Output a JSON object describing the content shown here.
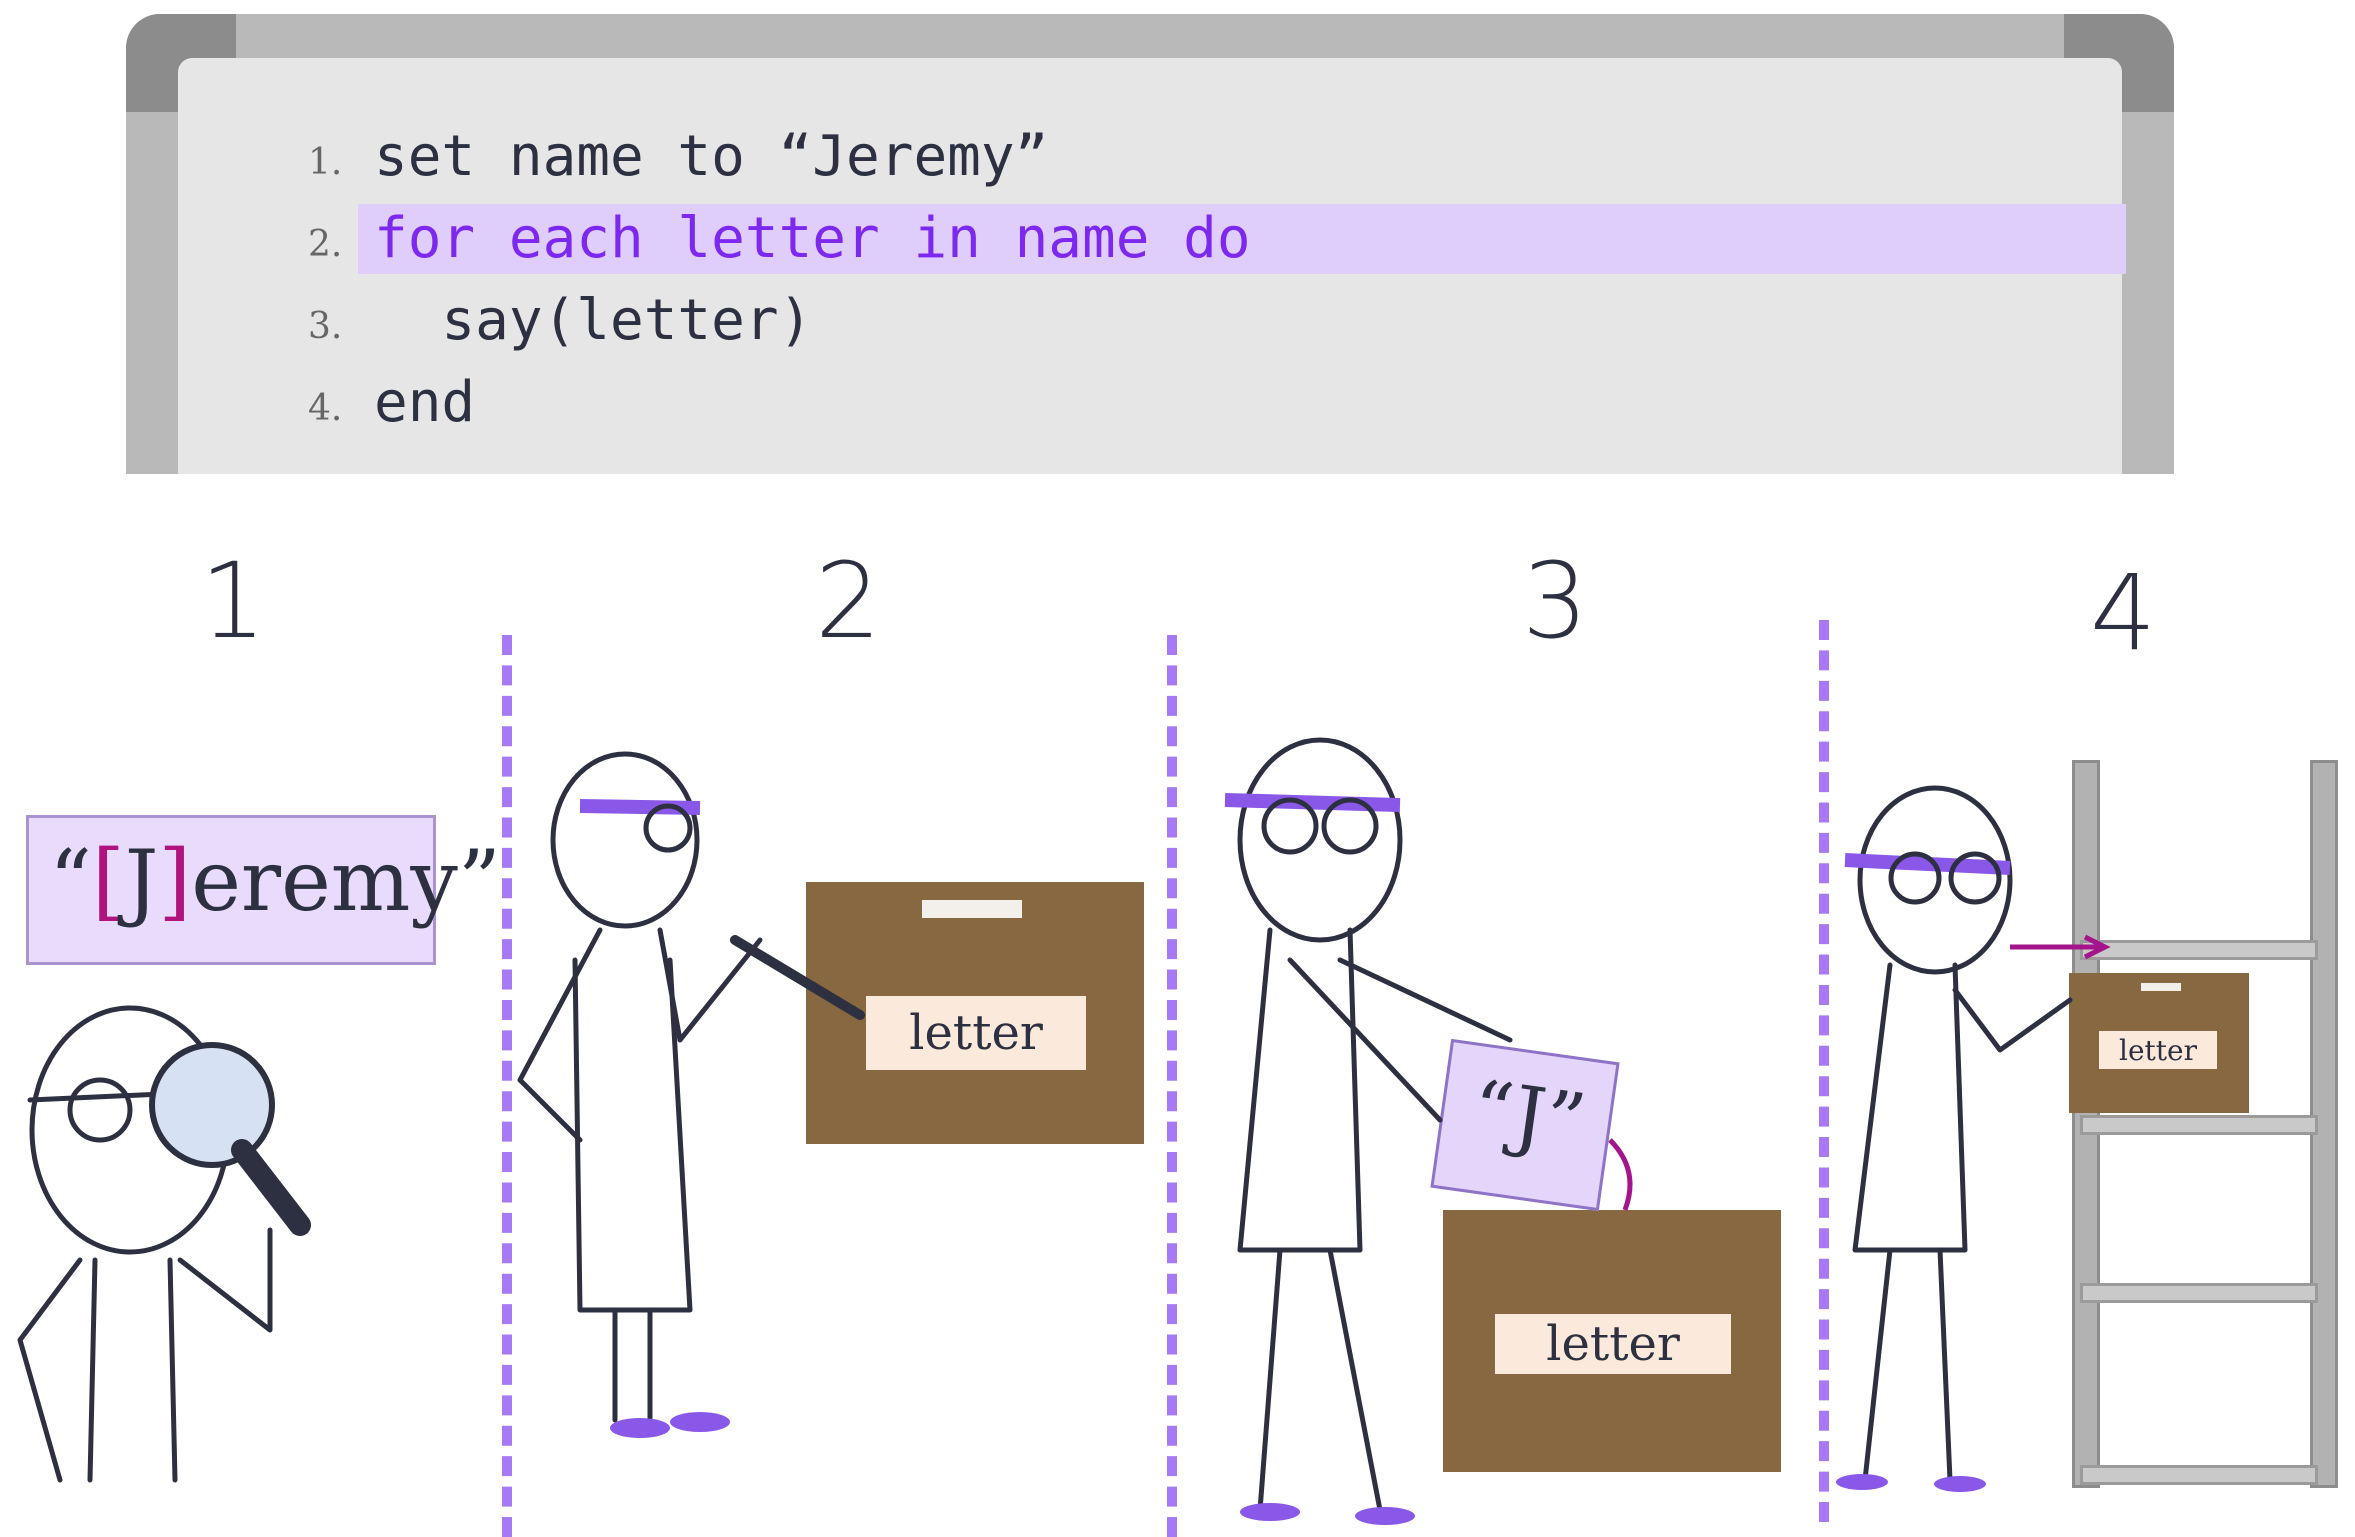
{
  "code": {
    "lines": [
      {
        "num": "1.",
        "text": "set name to “Jeremy”"
      },
      {
        "num": "2.",
        "text": "for each letter in name do"
      },
      {
        "num": "3.",
        "text": "  say(letter)"
      },
      {
        "num": "4.",
        "text": "end"
      }
    ],
    "active_line": 2
  },
  "panels": [
    {
      "number": "1"
    },
    {
      "number": "2"
    },
    {
      "number": "3"
    },
    {
      "number": "4"
    }
  ],
  "name_card": {
    "open_quote": "“",
    "open_bracket": "[",
    "first_letter": "J",
    "close_bracket": "]",
    "rest": "eremy",
    "close_quote": "”"
  },
  "box_label": "letter",
  "note_text": "“J”",
  "colors": {
    "highlight": "#dfcdfb",
    "keyword": "#7d28ee",
    "divider": "#a779f5",
    "box": "#876840",
    "arrow": "#a4158c"
  }
}
